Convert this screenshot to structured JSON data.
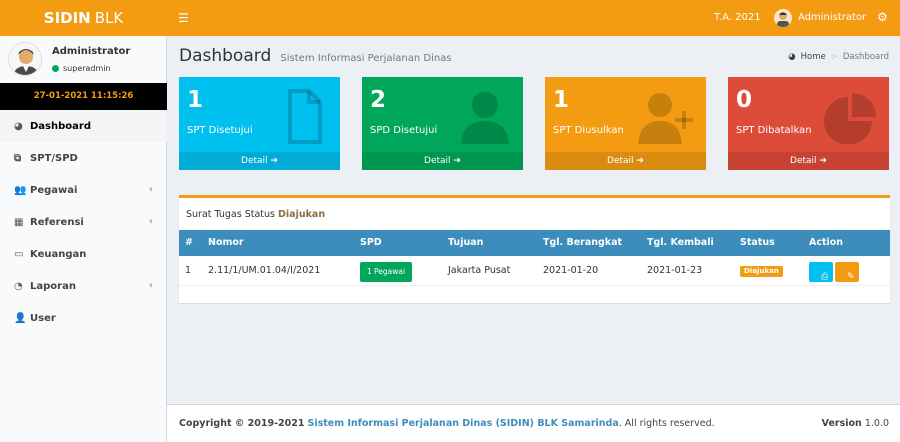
{
  "header": {
    "logo_bold": "SIDIN",
    "logo_rest": "BLK",
    "menu_icon": "hamburger-icon",
    "ta_label": "T.A. 2021",
    "user_name": "Administrator",
    "settings_icon": "cogs-icon"
  },
  "sidebar": {
    "user_name": "Administrator",
    "user_role": "superadmin",
    "clock": "27-01-2021 11:15:26",
    "items": [
      {
        "label": "Dashboard",
        "icon": "dashboard-icon",
        "active": true
      },
      {
        "label": "SPT/SPD",
        "icon": "copy-icon"
      },
      {
        "label": "Pegawai",
        "icon": "users-icon",
        "chevron": "‹"
      },
      {
        "label": "Referensi",
        "icon": "th-icon",
        "chevron": "‹"
      },
      {
        "label": "Keuangan",
        "icon": "money-icon"
      },
      {
        "label": "Laporan",
        "icon": "pie-chart-icon",
        "chevron": "‹"
      },
      {
        "label": "User",
        "icon": "user-icon"
      }
    ]
  },
  "page": {
    "title": "Dashboard",
    "subtitle": "Sistem Informasi Perjalanan Dinas",
    "breadcrumb": {
      "home": "Home",
      "current": "Dashboard"
    }
  },
  "stats": [
    {
      "value": "1",
      "label": "SPT Disetujui",
      "detail": "Detail",
      "icon": "file-icon",
      "color": "#00c0ef"
    },
    {
      "value": "2",
      "label": "SPD Disetujui",
      "detail": "Detail",
      "icon": "user-icon",
      "color": "#00a65a"
    },
    {
      "value": "1",
      "label": "SPT Diusulkan",
      "detail": "Detail",
      "icon": "user-plus-icon",
      "color": "#f39c12"
    },
    {
      "value": "0",
      "label": "SPT Dibatalkan",
      "detail": "Detail",
      "icon": "pie-chart-icon",
      "color": "#dd4b39"
    }
  ],
  "panel": {
    "title_prefix": "Surat Tugas Status",
    "title_status": "Diajukan",
    "columns": [
      "#",
      "Nomor",
      "SPD",
      "Tujuan",
      "Tgl. Berangkat",
      "Tgl. Kembali",
      "Status",
      "Action"
    ],
    "rows": [
      {
        "no": "1",
        "nomor": "2.11/1/UM.01.04/I/2021",
        "spd": "1 Pegawai",
        "tujuan": "Jakarta Pusat",
        "berangkat": "2021-01-20",
        "kembali": "2021-01-23",
        "status": "Diajukan"
      }
    ]
  },
  "footer": {
    "copyright": "Copyright © 2019-2021",
    "app_link": "Sistem Informasi Perjalanan Dinas (SIDIN) BLK Samarinda",
    "rights": ". All rights reserved.",
    "version_label": "Version",
    "version_value": "1.0.0"
  },
  "colors": {
    "accent": "#f39c12",
    "table_head": "#3c8dbc",
    "success": "#00a65a",
    "info": "#00c0ef",
    "danger": "#dd4b39"
  }
}
